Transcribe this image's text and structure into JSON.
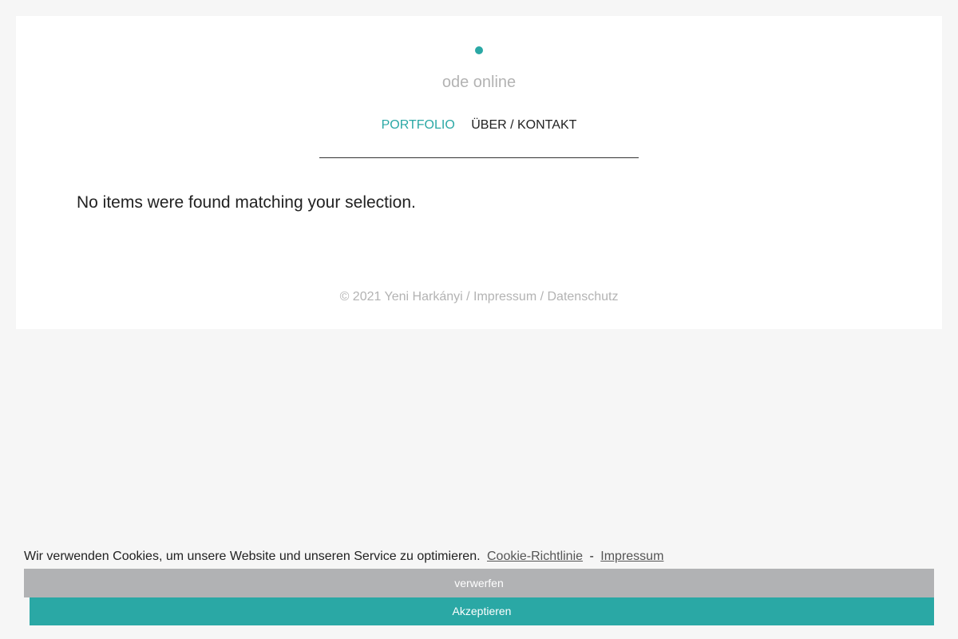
{
  "header": {
    "logo_icon": "dot-logo-icon",
    "site_title": "ode online",
    "accent_color": "#2aa8a5"
  },
  "nav": {
    "items": [
      {
        "label": "PORTFOLIO",
        "active": true
      },
      {
        "label": "ÜBER / KONTAKT",
        "active": false
      }
    ]
  },
  "main": {
    "empty_message": "No items were found matching your selection."
  },
  "footer": {
    "copyright": "© 2021 Yeni Harkányi",
    "separator": " / ",
    "impressum": "Impressum",
    "datenschutz": "Datenschutz"
  },
  "cookie_banner": {
    "text": "Wir verwenden Cookies, um unsere Website und unseren Service zu optimieren.",
    "policy_link": "Cookie-Richtlinie",
    "link_separator": "-",
    "impressum_link": "Impressum",
    "dismiss_label": "verwerfen",
    "accept_label": "Akzeptieren",
    "dismiss_color": "#b1b2b4",
    "accept_color": "#2aa8a5"
  }
}
